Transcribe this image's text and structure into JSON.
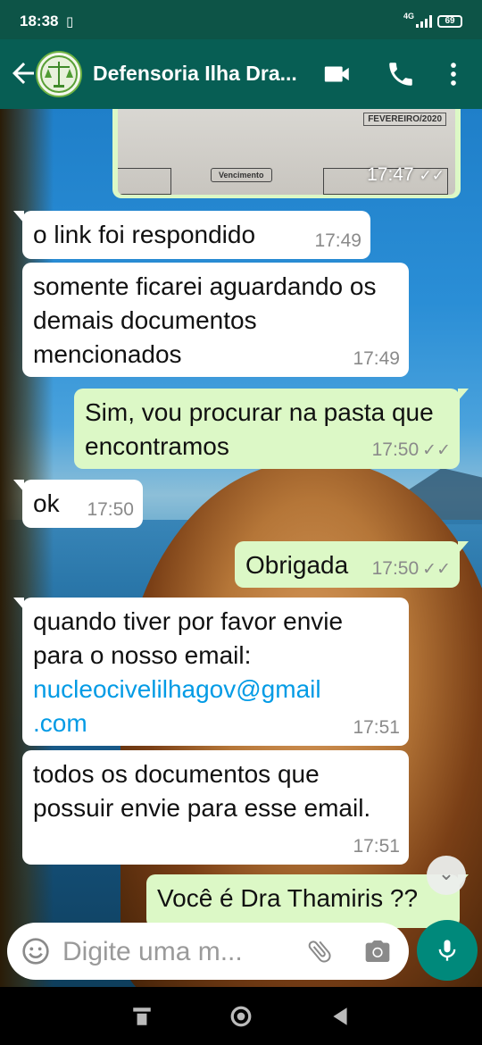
{
  "status_bar": {
    "time": "18:38",
    "network": "4G",
    "battery": "69"
  },
  "app_bar": {
    "title": "Defensoria Ilha Dra..."
  },
  "image_message": {
    "photo_label_top": "FEVEREIRO/2020",
    "photo_label_bottom": "Vencimento",
    "time": "17:47",
    "ticks": "✓✓"
  },
  "messages": [
    {
      "dir": "in",
      "text": "o link foi respondido",
      "time": "17:49"
    },
    {
      "dir": "in",
      "text": "somente ficarei aguardando os demais documentos mencionados",
      "time": "17:49"
    },
    {
      "dir": "out",
      "text": "Sim, vou procurar na pasta que encontramos",
      "time": "17:50",
      "ticks": "✓✓"
    },
    {
      "dir": "in",
      "text": "ok",
      "time": "17:50"
    },
    {
      "dir": "out",
      "text": "Obrigada",
      "time": "17:50",
      "ticks": "✓✓"
    },
    {
      "dir": "in",
      "text": "quando tiver por favor envie para o nosso email:",
      "link": "nucleocivelilhagov@gmail.com",
      "link_line1": "nucleocivelilhagov@gmail",
      "link_line2": ".com",
      "time": "17:51"
    },
    {
      "dir": "in",
      "text": "todos os documentos que possuir envie para esse email.",
      "time": "17:51"
    },
    {
      "dir": "out",
      "text": "Você é Dra Thamiris ??"
    }
  ],
  "input": {
    "placeholder": "Digite uma m..."
  },
  "colors": {
    "header": "#075e54",
    "status": "#0d5447",
    "outgoing": "#dcf8c6",
    "incoming": "#ffffff",
    "link": "#039be5",
    "mic": "#00897b"
  },
  "icons": [
    "back-arrow-icon",
    "video-call-icon",
    "phone-icon",
    "more-vert-icon",
    "emoji-icon",
    "attach-icon",
    "camera-icon",
    "mic-icon",
    "scroll-down-icon",
    "nav-recents-icon",
    "nav-home-icon",
    "nav-back-icon"
  ]
}
